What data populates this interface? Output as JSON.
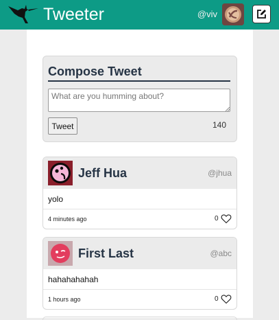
{
  "app": {
    "title": "Tweeter",
    "user_handle": "@viv",
    "brand_color": "#0d9b86",
    "icons": {
      "logo": "hummingbird-icon",
      "compose": "compose-icon"
    }
  },
  "compose": {
    "heading": "Compose Tweet",
    "placeholder": "What are you humming about?",
    "value": "",
    "submit_label": "Tweet",
    "char_count": "140"
  },
  "tweets": [
    {
      "name": "Jeff Hua",
      "handle": "@jhua",
      "text": "yolo",
      "time": "4 minutes ago",
      "likes": "0"
    },
    {
      "name": "First Last",
      "handle": "@abc",
      "text": "hahahahahah",
      "time": "1 hours ago",
      "likes": "0"
    }
  ]
}
